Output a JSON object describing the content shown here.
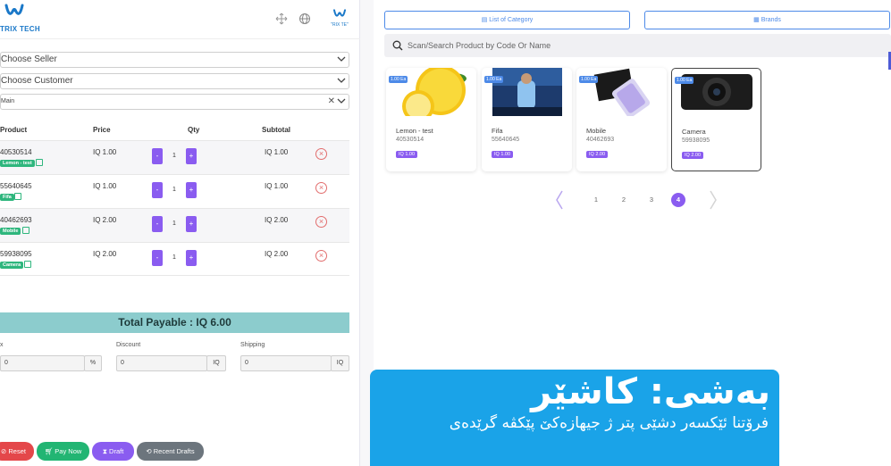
{
  "brand": {
    "name": "TRIX TECH",
    "mini_text": "\"RIX TE\""
  },
  "left": {
    "seller_select": "Choose Seller",
    "customer_select": "Choose Customer",
    "warehouse_select": "Main",
    "headers": {
      "product": "Product",
      "price": "Price",
      "qty": "Qty",
      "subtotal": "Subtotal"
    },
    "rows": [
      {
        "code": "40530514",
        "tag": "Lemon - test",
        "price": "IQ 1.00",
        "qty": "1",
        "subtotal": "IQ 1.00"
      },
      {
        "code": "55640645",
        "tag": "Fifa",
        "price": "IQ 1.00",
        "qty": "1",
        "subtotal": "IQ 1.00"
      },
      {
        "code": "40462693",
        "tag": "Mobile",
        "price": "IQ 2.00",
        "qty": "1",
        "subtotal": "IQ 2.00"
      },
      {
        "code": "59938095",
        "tag": "Camera",
        "price": "IQ 2.00",
        "qty": "1",
        "subtotal": "IQ 2.00"
      }
    ],
    "qty_minus": "-",
    "qty_plus": "+",
    "total_payable": "Total Payable : IQ 6.00",
    "fields": {
      "tax_label": "x",
      "tax_value": "0",
      "tax_suffix": "%",
      "discount_label": "Discount",
      "discount_value": "0",
      "discount_suffix": "IQ",
      "shipping_label": "Shipping",
      "shipping_value": "0",
      "shipping_suffix": "IQ"
    },
    "buttons": {
      "reset": "Reset",
      "pay_now": "Pay Now",
      "draft": "Draft",
      "recent_drafts": "Recent Drafts"
    }
  },
  "right": {
    "category_button": "List of Category",
    "brands_button": "Brands",
    "search_placeholder": "Scan/Search Product by Code Or Name",
    "products": [
      {
        "name": "Lemon - test",
        "code": "40530514",
        "stock": "1.00 Ea",
        "price": "IQ 1.00"
      },
      {
        "name": "Fifa",
        "code": "55640645",
        "stock": "1.00 Ea",
        "price": "IQ 1.00"
      },
      {
        "name": "Mobile",
        "code": "40462693",
        "stock": "1.00 Ea",
        "price": "IQ 2.00"
      },
      {
        "name": "Camera",
        "code": "59938095",
        "stock": "1.00 Ea",
        "price": "IQ 2.00"
      }
    ],
    "pages": [
      "1",
      "2",
      "3",
      "4"
    ],
    "active_page": "4"
  },
  "banner": {
    "title": "بەشی: کاشێر",
    "subtitle": "فرۆتنا ئێکسەر دشێی پتر ژ جیهازەکێ پێکڤە گرێدەی"
  },
  "colors": {
    "accent": "#8a5cf0",
    "green": "#2eb67d",
    "blue": "#4d8ae8",
    "banner": "#1aa3e8",
    "total_bg": "#8ccccd"
  }
}
